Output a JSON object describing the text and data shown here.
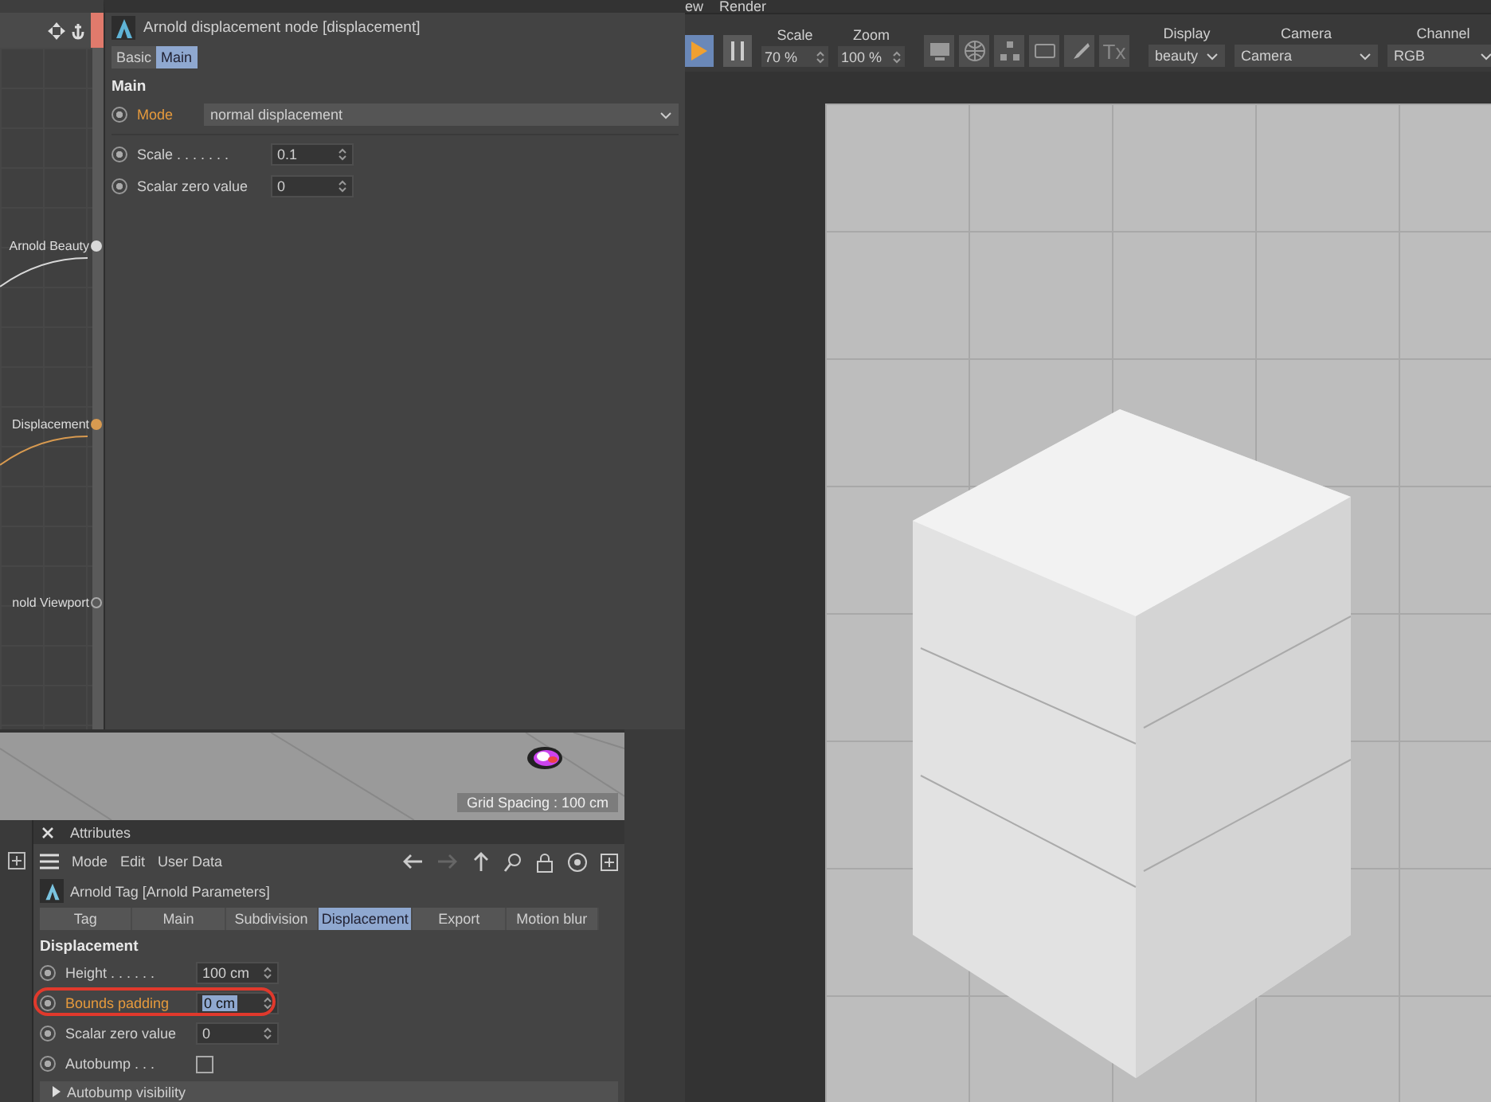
{
  "menu_bar": {
    "items": [
      "ew",
      "Render"
    ]
  },
  "node_editor": {
    "ports": [
      {
        "label": "Arnold Beauty",
        "connected": true,
        "color": "#d8d8d8"
      },
      {
        "label": "Displacement",
        "connected": true,
        "color": "#d89a50"
      },
      {
        "label": "nold Viewport",
        "connected": false
      }
    ]
  },
  "node_panel": {
    "title": "Arnold displacement node [displacement]",
    "tabs": [
      {
        "label": "Basic",
        "selected": false
      },
      {
        "label": "Main",
        "selected": true
      }
    ],
    "section": "Main",
    "params": [
      {
        "kind": "dropdown",
        "label": "Mode",
        "value": "normal displacement",
        "highlighted": true
      },
      {
        "kind": "number",
        "label": "Scale . . . . . . .",
        "value": "0.1",
        "highlighted": false
      },
      {
        "kind": "number",
        "label": "Scalar zero value",
        "value": "0",
        "highlighted": false
      }
    ]
  },
  "toolbar": {
    "scale": {
      "label": "Scale",
      "value": "70 %"
    },
    "zoom": {
      "label": "Zoom",
      "value": "100 %"
    },
    "text_button": "Tx",
    "dropdowns": [
      {
        "label": "Display",
        "value": "beauty"
      },
      {
        "label": "Camera",
        "value": "Camera"
      },
      {
        "label": "Channel",
        "value": "RGB"
      }
    ]
  },
  "viewport": {
    "grid_spacing": "Grid Spacing : 100 cm"
  },
  "attributes": {
    "title": "Attributes",
    "menu": [
      "Mode",
      "Edit",
      "User Data"
    ],
    "object": "Arnold Tag [Arnold Parameters]",
    "tabs": [
      {
        "label": "Tag",
        "selected": false
      },
      {
        "label": "Main",
        "selected": false
      },
      {
        "label": "Subdivision",
        "selected": false
      },
      {
        "label": "Displacement",
        "selected": true
      },
      {
        "label": "Export",
        "selected": false
      },
      {
        "label": "Motion blur",
        "selected": false
      }
    ],
    "section": "Displacement",
    "params": [
      {
        "kind": "number",
        "label": "Height . . . . . .",
        "value": "100 cm",
        "highlighted": false,
        "circled": false,
        "editing": false
      },
      {
        "kind": "number",
        "label": "Bounds padding",
        "value": "0 cm",
        "highlighted": true,
        "circled": true,
        "editing": true
      },
      {
        "kind": "number",
        "label": "Scalar zero value",
        "value": "0",
        "highlighted": false,
        "circled": false,
        "editing": false
      },
      {
        "kind": "checkbox",
        "label": "Autobump . . .",
        "checked": false,
        "highlighted": false,
        "circled": false
      }
    ],
    "group": {
      "label": "Autobump visibility",
      "expanded": false
    }
  }
}
